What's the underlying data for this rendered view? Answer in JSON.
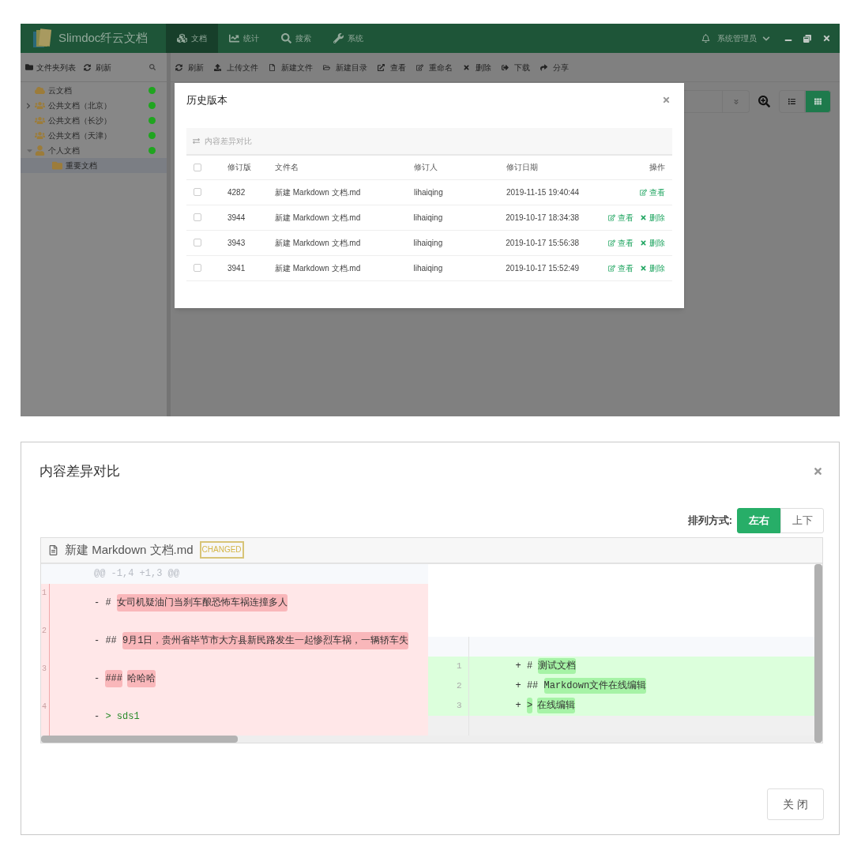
{
  "app": {
    "logo_text": "Slimdoc纤云文档",
    "nav": [
      {
        "label": "文档",
        "selected": true
      },
      {
        "label": "统计",
        "selected": false
      },
      {
        "label": "搜索",
        "selected": false
      },
      {
        "label": "系统",
        "selected": false
      }
    ],
    "user": "系统管理员",
    "sidebar": {
      "title": "文件夹列表",
      "refresh": "刷新",
      "tree": [
        {
          "label": "云文档",
          "kind": "cloud",
          "has_children": false,
          "expanded": false,
          "online": true,
          "selected": false
        },
        {
          "label": "公共文档（北京）",
          "kind": "group",
          "has_children": true,
          "expanded": false,
          "online": true,
          "selected": false
        },
        {
          "label": "公共文档（长沙）",
          "kind": "group",
          "has_children": false,
          "expanded": false,
          "online": true,
          "selected": false
        },
        {
          "label": "公共文档（天津）",
          "kind": "group",
          "has_children": false,
          "expanded": false,
          "online": true,
          "selected": false
        },
        {
          "label": "个人文档",
          "kind": "user",
          "has_children": true,
          "expanded": true,
          "online": true,
          "selected": false,
          "children": [
            {
              "label": "重要文档",
              "kind": "folder",
              "has_children": false,
              "expanded": false,
              "selected": true
            }
          ]
        }
      ]
    },
    "toolbar": [
      "刷新",
      "上传文件",
      "新建文件",
      "新建目录",
      "查看",
      "重命名",
      "删除",
      "下载",
      "分享"
    ],
    "views": [
      {
        "kind": "list",
        "selected": false
      },
      {
        "kind": "grid",
        "selected": true
      }
    ],
    "history_dialog": {
      "title": "历史版本",
      "compare_button": {
        "label": "内容差异对比",
        "disabled": true
      },
      "select_all": {
        "checked": false
      },
      "columns": [
        "修订版",
        "文件名",
        "修订人",
        "修订日期",
        "操作"
      ],
      "rows": [
        {
          "checked": false,
          "cells": [
            "4282",
            "新建 Markdown 文档.md",
            "lihaiqing",
            "2019-11-15 19:40:44"
          ],
          "actions": [
            {
              "kind": "view",
              "label": "查看"
            }
          ]
        },
        {
          "checked": false,
          "cells": [
            "3944",
            "新建 Markdown 文档.md",
            "lihaiqing",
            "2019-10-17 18:34:38"
          ],
          "actions": [
            {
              "kind": "view",
              "label": "查看"
            },
            {
              "kind": "delete",
              "label": "删除"
            }
          ]
        },
        {
          "checked": false,
          "cells": [
            "3943",
            "新建 Markdown 文档.md",
            "lihaiqing",
            "2019-10-17 15:56:38"
          ],
          "actions": [
            {
              "kind": "view",
              "label": "查看"
            },
            {
              "kind": "delete",
              "label": "删除"
            }
          ]
        },
        {
          "checked": false,
          "cells": [
            "3941",
            "新建 Markdown 文档.md",
            "lihaiqing",
            "2019-10-17 15:52:49"
          ],
          "actions": [
            {
              "kind": "view",
              "label": "查看"
            },
            {
              "kind": "delete",
              "label": "删除"
            }
          ]
        }
      ]
    }
  },
  "diff_dialog": {
    "title": "内容差异对比",
    "layout_label": "排列方式:",
    "layouts": [
      {
        "label": "左右",
        "selected": true
      },
      {
        "label": "上下",
        "selected": false
      }
    ],
    "file_name": "新建 Markdown 文档.md",
    "badge": "CHANGED",
    "hunk": "@@ -1,4 +1,3 @@",
    "left_lines": [
      {
        "number": "1",
        "segments": [
          {
            "text": "- # ",
            "highlight": false
          },
          {
            "text": "女司机疑油门当刹车酿恐怖车祸连撞多人",
            "highlight": true
          }
        ]
      },
      {
        "number": "2",
        "segments": [
          {
            "text": "- ## ",
            "highlight": false
          },
          {
            "text": "9月1日，贵州省毕节市大方县新民路发生一起惨烈车祸，一辆轿车失",
            "highlight": true
          }
        ]
      },
      {
        "number": "3",
        "segments": [
          {
            "text": "- ",
            "highlight": false
          },
          {
            "text": "###",
            "highlight": true
          },
          {
            "text": "哈哈哈",
            "highlight": true
          }
        ]
      },
      {
        "number": "4",
        "segments": [
          {
            "text": "- ",
            "highlight": false
          },
          {
            "text": "> sds1",
            "highlight": false,
            "kind": "quote"
          }
        ]
      }
    ],
    "right_lines": [
      {
        "number": "1",
        "segments": [
          {
            "text": "+ # ",
            "highlight": false
          },
          {
            "text": "测试文档",
            "highlight": true
          }
        ]
      },
      {
        "number": "2",
        "segments": [
          {
            "text": "+ ## ",
            "highlight": false
          },
          {
            "text": "Markdown文件在线编辑",
            "highlight": true
          }
        ]
      },
      {
        "number": "3",
        "segments": [
          {
            "text": "+ ",
            "highlight": false
          },
          {
            "text": ">",
            "highlight": true
          },
          {
            "text": "在线编辑",
            "highlight": true
          }
        ]
      }
    ],
    "close_button": "关 闭"
  }
}
